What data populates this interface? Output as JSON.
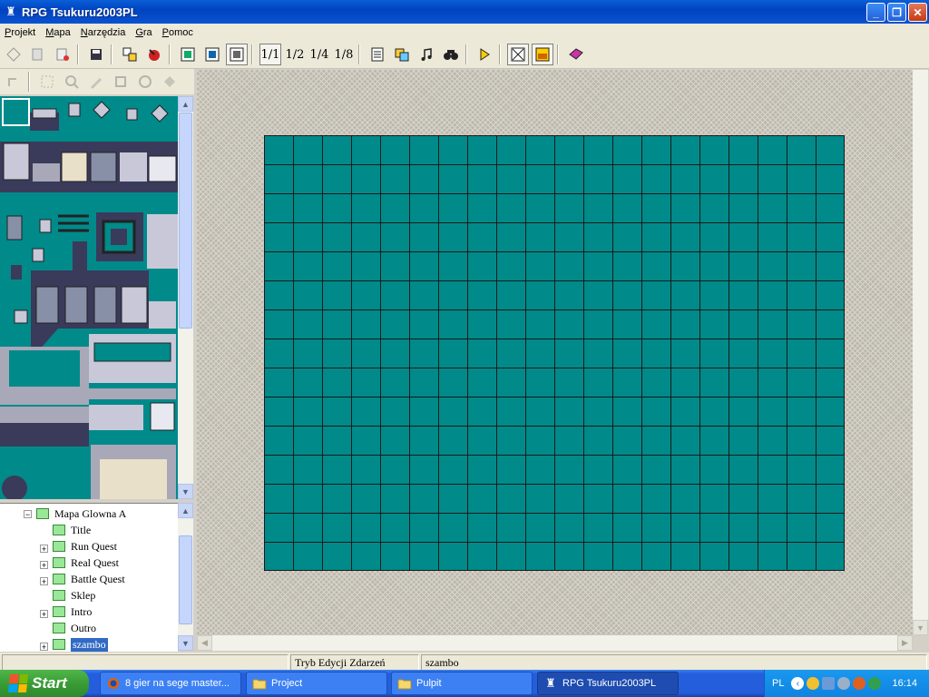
{
  "window": {
    "title": "RPG Tsukuru2003PL",
    "buttons": {
      "minimize": "_",
      "maximize": "❐",
      "close": "✕"
    }
  },
  "menu": [
    "Projekt",
    "Mapa",
    "Narzędzia",
    "Gra",
    "Pomoc"
  ],
  "toolbar": {
    "zoom_labels": [
      "1/1",
      "1/2",
      "1/4",
      "1/8"
    ]
  },
  "map_tree": {
    "root": "Mapa Glowna A",
    "items": [
      {
        "label": "Title",
        "expandable": false,
        "selected": false
      },
      {
        "label": "Run Quest",
        "expandable": true,
        "selected": false
      },
      {
        "label": "Real Quest",
        "expandable": true,
        "selected": false
      },
      {
        "label": "Battle Quest",
        "expandable": true,
        "selected": false
      },
      {
        "label": "Sklep",
        "expandable": false,
        "selected": false
      },
      {
        "label": "Intro",
        "expandable": true,
        "selected": false
      },
      {
        "label": "Outro",
        "expandable": false,
        "selected": false
      },
      {
        "label": "szambo",
        "expandable": true,
        "selected": true
      }
    ]
  },
  "map": {
    "columns": 20,
    "rows": 15,
    "fill_color": "#008a8a"
  },
  "statusbar": {
    "mode": "Tryb Edycji Zdarzeń",
    "map_name": "szambo"
  },
  "taskbar": {
    "start": "Start",
    "tasks": [
      {
        "label": "8 gier na sege master...",
        "icon": "firefox-icon",
        "active": false
      },
      {
        "label": "Project",
        "icon": "folder-icon",
        "active": false
      },
      {
        "label": "Pulpit",
        "icon": "folder-icon",
        "active": false
      },
      {
        "label": "RPG Tsukuru2003PL",
        "icon": "rpg-maker-icon",
        "active": true
      }
    ],
    "language": "PL",
    "clock": "16:14"
  },
  "colors": {
    "teal": "#008a8a",
    "titlebar": "#0043c0",
    "taskbar": "#245edc",
    "start_green": "#3a9c36"
  }
}
